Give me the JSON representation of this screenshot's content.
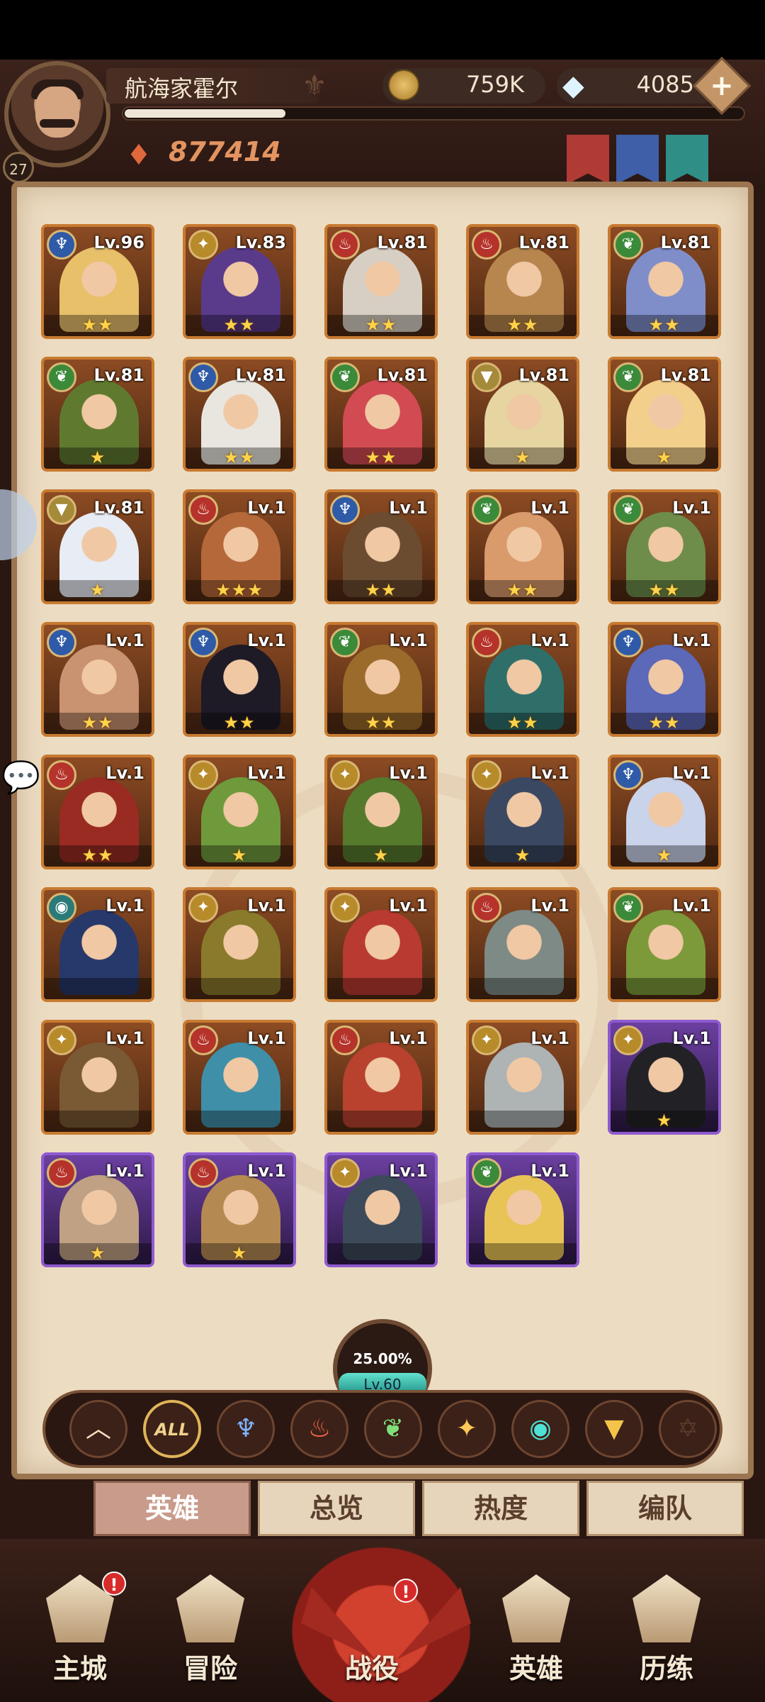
{
  "player": {
    "name": "航海家霍尔",
    "level": "27",
    "power": "877414",
    "xp_fraction": 0.26
  },
  "currency": {
    "gold": "759K",
    "gems": "4085",
    "plus": "+"
  },
  "heroes": [
    {
      "lv": "Lv.96",
      "faction": "water",
      "stars": "★★",
      "frame": "orange",
      "tint": "#e8c06a"
    },
    {
      "lv": "Lv.83",
      "faction": "light",
      "stars": "★★",
      "frame": "orange",
      "tint": "#5a3a8a"
    },
    {
      "lv": "Lv.81",
      "faction": "fire",
      "stars": "★★",
      "frame": "orange",
      "tint": "#d7cfc4"
    },
    {
      "lv": "Lv.81",
      "faction": "fire",
      "stars": "★★",
      "frame": "orange",
      "tint": "#b7864e"
    },
    {
      "lv": "Lv.81",
      "faction": "nature",
      "stars": "★★",
      "frame": "orange",
      "tint": "#7f8ec9"
    },
    {
      "lv": "Lv.81",
      "faction": "nature",
      "stars": "★",
      "frame": "orange",
      "tint": "#5f7a2e"
    },
    {
      "lv": "Lv.81",
      "faction": "water",
      "stars": "★★",
      "frame": "orange",
      "tint": "#e9e6df"
    },
    {
      "lv": "Lv.81",
      "faction": "nature",
      "stars": "★★",
      "frame": "orange",
      "tint": "#d24a52"
    },
    {
      "lv": "Lv.81",
      "faction": "holy",
      "stars": "★",
      "frame": "orange",
      "tint": "#e6d4a1"
    },
    {
      "lv": "Lv.81",
      "faction": "nature",
      "stars": "★",
      "frame": "orange",
      "tint": "#f2cf8a"
    },
    {
      "lv": "Lv.81",
      "faction": "holy",
      "stars": "★",
      "frame": "orange",
      "tint": "#e8ecf4"
    },
    {
      "lv": "Lv.1",
      "faction": "fire",
      "stars": "★★★",
      "frame": "orange",
      "tint": "#b5683a"
    },
    {
      "lv": "Lv.1",
      "faction": "water",
      "stars": "★★",
      "frame": "orange",
      "tint": "#6c4c30"
    },
    {
      "lv": "Lv.1",
      "faction": "nature",
      "stars": "★★",
      "frame": "orange",
      "tint": "#d99a6c"
    },
    {
      "lv": "Lv.1",
      "faction": "nature",
      "stars": "★★",
      "frame": "orange",
      "tint": "#6e8d4a"
    },
    {
      "lv": "Lv.1",
      "faction": "water",
      "stars": "★★",
      "frame": "orange",
      "tint": "#c99270"
    },
    {
      "lv": "Lv.1",
      "faction": "water",
      "stars": "★★",
      "frame": "orange",
      "tint": "#1e1a26"
    },
    {
      "lv": "Lv.1",
      "faction": "nature",
      "stars": "★★",
      "frame": "orange",
      "tint": "#9a6b2a"
    },
    {
      "lv": "Lv.1",
      "faction": "fire",
      "stars": "★★",
      "frame": "orange",
      "tint": "#2f6f6a"
    },
    {
      "lv": "Lv.1",
      "faction": "water",
      "stars": "★★",
      "frame": "orange",
      "tint": "#5c68b8"
    },
    {
      "lv": "Lv.1",
      "faction": "fire",
      "stars": "★★",
      "frame": "orange",
      "tint": "#9a2b22"
    },
    {
      "lv": "Lv.1",
      "faction": "light",
      "stars": "★",
      "frame": "orange",
      "tint": "#6f9a3c"
    },
    {
      "lv": "Lv.1",
      "faction": "light",
      "stars": "★",
      "frame": "orange",
      "tint": "#557a2c"
    },
    {
      "lv": "Lv.1",
      "faction": "light",
      "stars": "★",
      "frame": "orange",
      "tint": "#3a4862"
    },
    {
      "lv": "Lv.1",
      "faction": "water",
      "stars": "★",
      "frame": "orange",
      "tint": "#c9d3ea"
    },
    {
      "lv": "Lv.1",
      "faction": "void",
      "stars": "",
      "frame": "orange",
      "tint": "#27386a"
    },
    {
      "lv": "Lv.1",
      "faction": "light",
      "stars": "",
      "frame": "orange",
      "tint": "#8a7a2c"
    },
    {
      "lv": "Lv.1",
      "faction": "light",
      "stars": "",
      "frame": "orange",
      "tint": "#b83a30"
    },
    {
      "lv": "Lv.1",
      "faction": "fire",
      "stars": "",
      "frame": "orange",
      "tint": "#7e8a86"
    },
    {
      "lv": "Lv.1",
      "faction": "nature",
      "stars": "",
      "frame": "orange",
      "tint": "#7c9a3a"
    },
    {
      "lv": "Lv.1",
      "faction": "light",
      "stars": "",
      "frame": "orange",
      "tint": "#7a5a34"
    },
    {
      "lv": "Lv.1",
      "faction": "fire",
      "stars": "",
      "frame": "orange",
      "tint": "#3f8fa8"
    },
    {
      "lv": "Lv.1",
      "faction": "fire",
      "stars": "",
      "frame": "orange",
      "tint": "#b8422e"
    },
    {
      "lv": "Lv.1",
      "faction": "light",
      "stars": "",
      "frame": "orange",
      "tint": "#aeb3b4"
    },
    {
      "lv": "Lv.1",
      "faction": "light",
      "stars": "★",
      "frame": "purple",
      "tint": "#222226"
    },
    {
      "lv": "Lv.1",
      "faction": "fire",
      "stars": "★",
      "frame": "purple",
      "tint": "#c0a184"
    },
    {
      "lv": "Lv.1",
      "faction": "fire",
      "stars": "★",
      "frame": "purple",
      "tint": "#b58a52"
    },
    {
      "lv": "Lv.1",
      "faction": "light",
      "stars": "",
      "frame": "purple",
      "tint": "#3c4a5a"
    },
    {
      "lv": "Lv.1",
      "faction": "nature",
      "stars": "",
      "frame": "purple",
      "tint": "#e8c457"
    }
  ],
  "faction_colors": {
    "water": "#2e5aa8",
    "light": "#b78a2a",
    "fire": "#b5332a",
    "nature": "#3b8a3a",
    "holy": "#a58a3a",
    "void": "#2a7a7a"
  },
  "faction_glyphs": {
    "water": "♆",
    "light": "✦",
    "fire": "♨",
    "nature": "❦",
    "holy": "▼",
    "void": "◉"
  },
  "collection": {
    "percent": "25.00%",
    "level": "Lv.60"
  },
  "filters": [
    {
      "id": "collapse",
      "icon": "chevron-up-icon",
      "glyph": "︿",
      "color": "#f1e3c4"
    },
    {
      "id": "all",
      "icon": "all-icon",
      "glyph": "ALL",
      "color": "#f1d28a"
    },
    {
      "id": "water",
      "icon": "water-faction-icon",
      "glyph": "♆",
      "color": "#7fb2ff"
    },
    {
      "id": "fire",
      "icon": "fire-faction-icon",
      "glyph": "♨",
      "color": "#ff6a4e"
    },
    {
      "id": "nature",
      "icon": "nature-faction-icon",
      "glyph": "❦",
      "color": "#7fe07a"
    },
    {
      "id": "light",
      "icon": "light-faction-icon",
      "glyph": "✦",
      "color": "#ffc857"
    },
    {
      "id": "void",
      "icon": "void-faction-icon",
      "glyph": "◉",
      "color": "#4fe0d6"
    },
    {
      "id": "holy",
      "icon": "holy-faction-icon",
      "glyph": "▼",
      "color": "#f3c34a"
    },
    {
      "id": "locked",
      "icon": "hexagram-icon",
      "glyph": "✡",
      "color": "#5b3a2a"
    }
  ],
  "tabs": [
    "英雄",
    "总览",
    "热度",
    "编队"
  ],
  "bottom_nav": [
    {
      "label": "主城",
      "icon": "castle-icon",
      "alert": "!"
    },
    {
      "label": "冒险",
      "icon": "scroll-map-icon",
      "alert": ""
    },
    {
      "label": "战役",
      "icon": "dragon-icon",
      "alert": "!"
    },
    {
      "label": "英雄",
      "icon": "hero-helmet-icon",
      "alert": ""
    },
    {
      "label": "历练",
      "icon": "trial-icon",
      "alert": ""
    }
  ]
}
